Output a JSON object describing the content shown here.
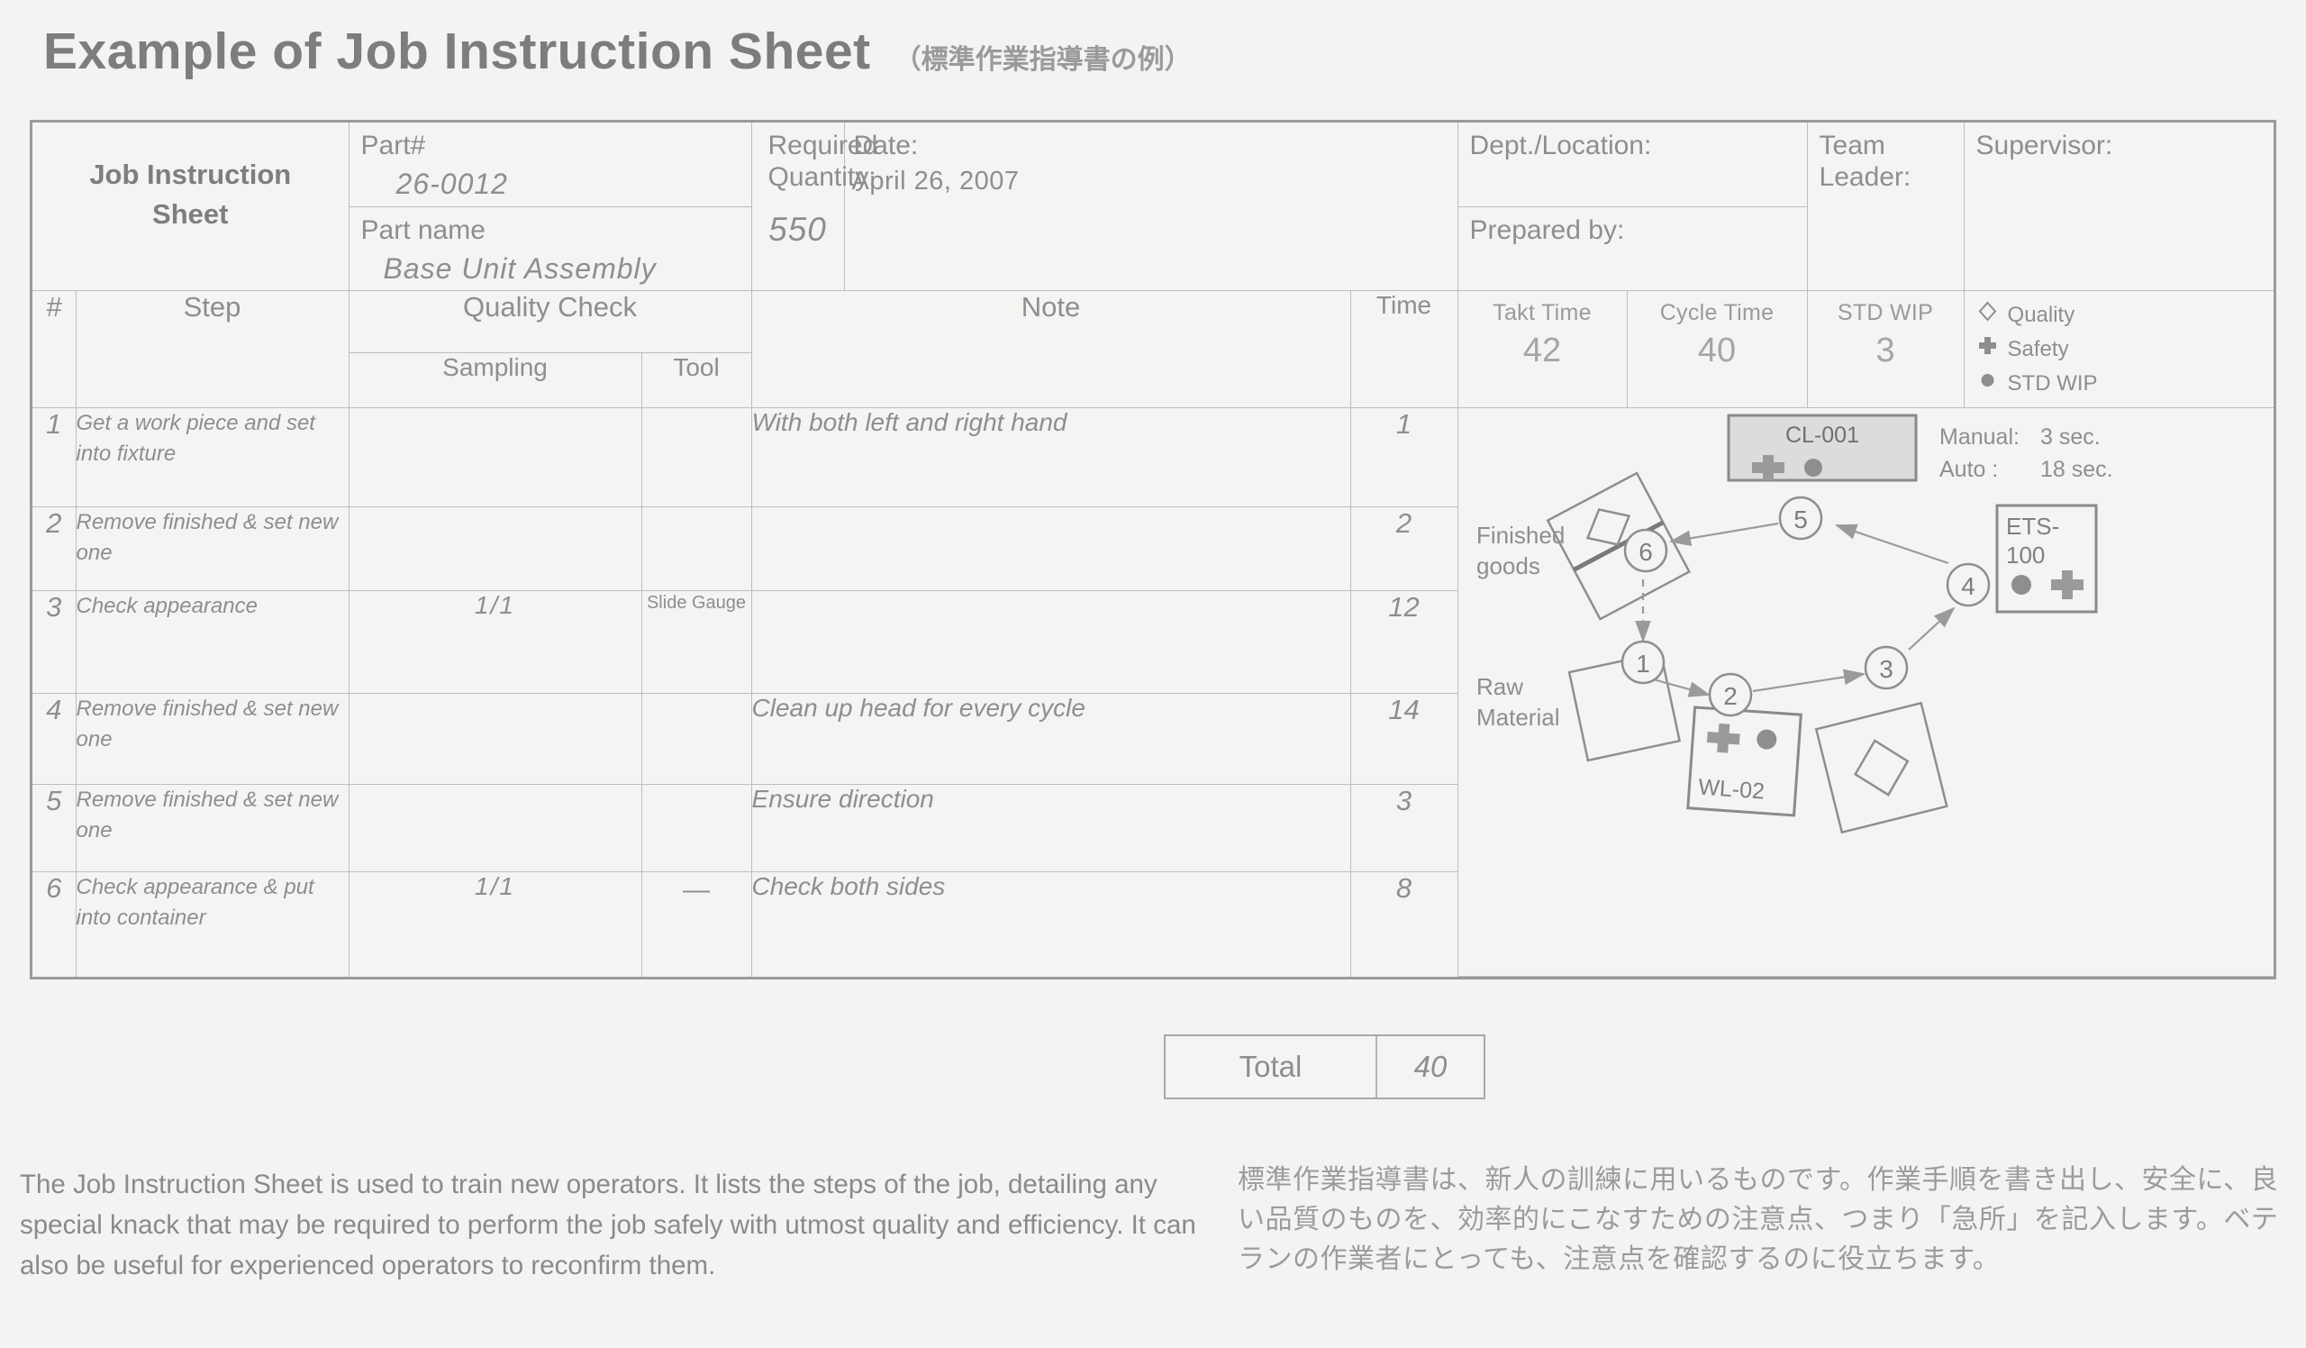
{
  "title": {
    "main": "Example of Job Instruction Sheet",
    "japanese": "（標準作業指導書の例）"
  },
  "header": {
    "sheet_title_line1": "Job Instruction",
    "sheet_title_line2": "Sheet",
    "part_number_label": "Part#",
    "part_number_value": "26-0012",
    "part_name_label": "Part name",
    "part_name_value": "Base Unit Assembly",
    "required_quantity_label_line1": "Required",
    "required_quantity_label_line2": "Quantity:",
    "required_quantity_value": "550",
    "date_label": "Date:",
    "date_value": "April 26, 2007",
    "dept_location_label": "Dept./Location:",
    "dept_location_value": "",
    "prepared_by_label": "Prepared by:",
    "prepared_by_value": "",
    "team_leader_label_line1": "Team",
    "team_leader_label_line2": "Leader:",
    "team_leader_value": "",
    "supervisor_label": "Supervisor:",
    "supervisor_value": ""
  },
  "table": {
    "columns": {
      "number": "#",
      "step": "Step",
      "quality_check": "Quality Check",
      "sampling": "Sampling",
      "tool": "Tool",
      "note": "Note",
      "time": "Time"
    },
    "rows": [
      {
        "number": "1",
        "step": "Get a work piece and set into fixture",
        "sampling": "",
        "tool": "",
        "note": "With both left and right hand",
        "time": "1"
      },
      {
        "number": "2",
        "step": "Remove finished & set new one",
        "sampling": "",
        "tool": "",
        "note": "",
        "time": "2"
      },
      {
        "number": "3",
        "step": "Check appearance",
        "sampling": "1/1",
        "tool": "Slide Gauge",
        "note": "",
        "time": "12"
      },
      {
        "number": "4",
        "step": "Remove finished & set new one",
        "sampling": "",
        "tool": "",
        "note": "Clean up head for every cycle",
        "time": "14"
      },
      {
        "number": "5",
        "step": "Remove finished & set new one",
        "sampling": "",
        "tool": "",
        "note": "Ensure direction",
        "time": "3"
      },
      {
        "number": "6",
        "step": "Check appearance & put into container",
        "sampling": "1/1",
        "tool": "—",
        "note": "Check both sides",
        "time": "8"
      }
    ],
    "total_label": "Total",
    "total_value": "40"
  },
  "metrics": {
    "takt_time_label": "Takt Time",
    "takt_time_value": "42",
    "cycle_time_label": "Cycle Time",
    "cycle_time_value": "40",
    "std_wip_label": "STD WIP",
    "std_wip_value": "3"
  },
  "legend": {
    "quality": "Quality",
    "safety": "Safety",
    "std_wip": "STD WIP"
  },
  "diagram": {
    "finished_goods_line1": "Finished",
    "finished_goods_line2": "goods",
    "raw_material_line1": "Raw",
    "raw_material_line2": "Material",
    "machine_cl001": "CL-001",
    "machine_ets100_line1": "ETS-",
    "machine_ets100_line2": "100",
    "machine_wl02": "WL-02",
    "manual_label": "Manual:",
    "manual_value": "3 sec.",
    "auto_label": "Auto  :",
    "auto_value": "18 sec.",
    "steps": [
      "1",
      "2",
      "3",
      "4",
      "5",
      "6"
    ]
  },
  "footer": {
    "english": "The Job Instruction Sheet is used to train new operators. It lists the steps of the job, detailing any special knack that may be required to perform the job safely with utmost quality and efficiency. It can also be useful for experienced operators to reconfirm them.",
    "japanese": "標準作業指導書は、新人の訓練に用いるものです。作業手順を書き出し、安全に、良い品質のものを、効率的にこなすための注意点、つまり「急所」を記入します。ベテランの作業者にとっても、注意点を確認するのに役立ちます。"
  },
  "colors": {
    "text": "#8a8a8a",
    "border": "#bdbdbb",
    "frame": "#9a9a9a",
    "background": "#f3f3f1"
  }
}
